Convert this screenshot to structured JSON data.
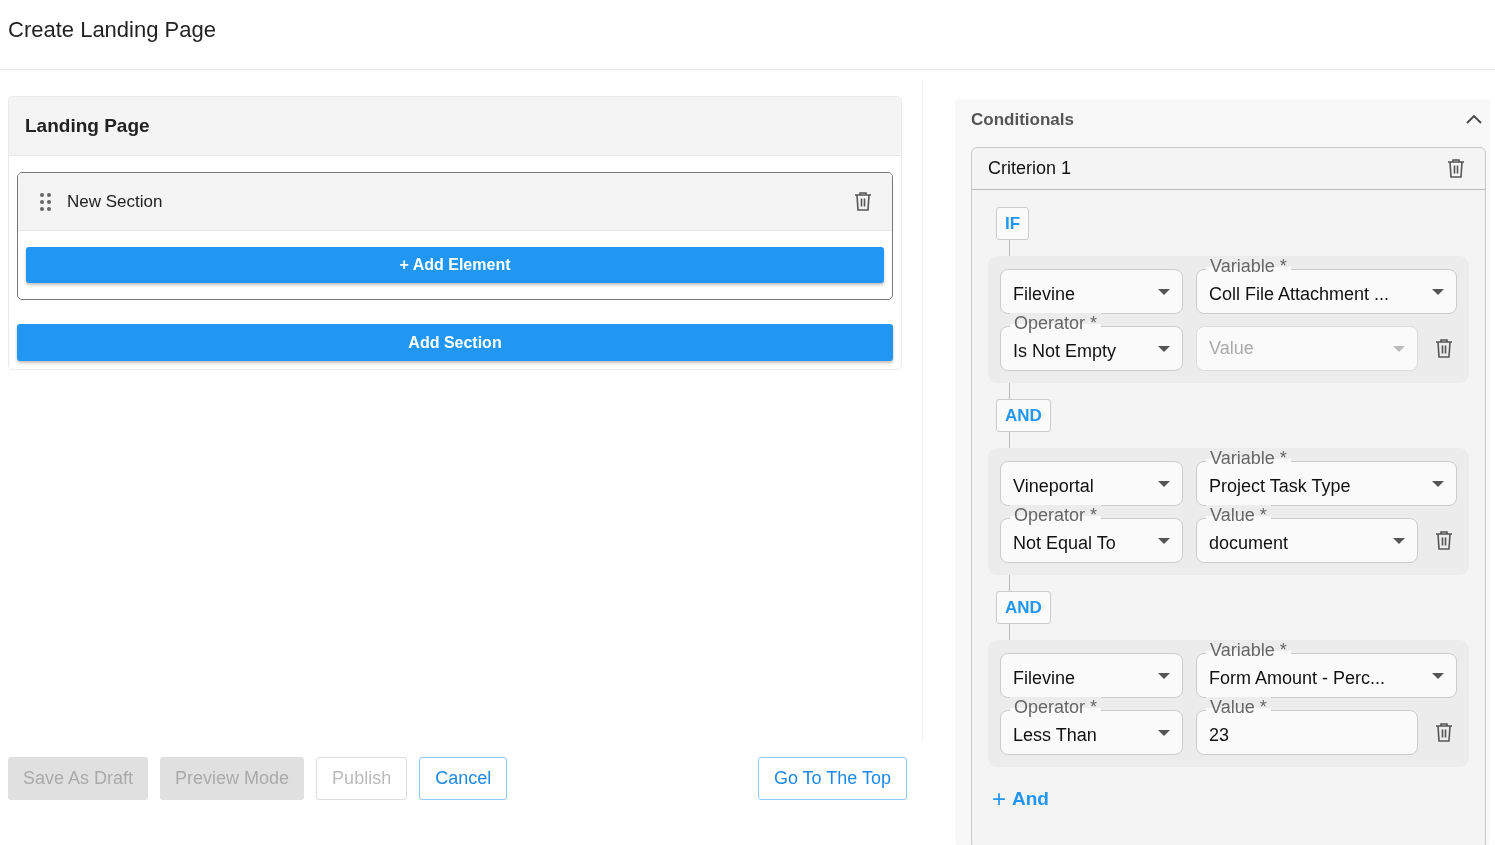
{
  "page_title": "Create Landing Page",
  "landing_page": {
    "title": "Landing Page",
    "sections": [
      {
        "title": "New Section",
        "add_element": "+ Add Element"
      }
    ],
    "add_section": "Add Section"
  },
  "footer_buttons": [
    {
      "label": "Save As Draft",
      "kind": "filled",
      "disabled": true
    },
    {
      "label": "Preview Mode",
      "kind": "filled",
      "disabled": true
    },
    {
      "label": "Publish",
      "kind": "outlined",
      "disabled": true
    },
    {
      "label": "Cancel",
      "kind": "outlined",
      "disabled": false
    }
  ],
  "go_top": {
    "label": "Go To The Top"
  },
  "conditionals": {
    "title": "Conditionals",
    "expanded": true,
    "criteria": [
      {
        "title": "Criterion 1",
        "conditions": [
          {
            "connector": "IF",
            "source": "Filevine",
            "variable": {
              "label": "Variable *",
              "value": "Coll File Attachment ..."
            },
            "operator": {
              "label": "Operator *",
              "value": "Is Not Empty"
            },
            "value": {
              "kind": "select",
              "placeholder": "Value",
              "disabled": true
            }
          },
          {
            "connector": "AND",
            "source": "Vineportal",
            "variable": {
              "label": "Variable *",
              "value": "Project Task Type"
            },
            "operator": {
              "label": "Operator *",
              "value": "Not Equal To"
            },
            "value": {
              "kind": "select",
              "label": "Value *",
              "value": "document",
              "disabled": false
            }
          },
          {
            "connector": "AND",
            "source": "Filevine",
            "variable": {
              "label": "Variable *",
              "value": "Form Amount - Perc..."
            },
            "operator": {
              "label": "Operator *",
              "value": "Less Than"
            },
            "value": {
              "kind": "text",
              "label": "Value *",
              "value": "23",
              "disabled": false
            }
          }
        ],
        "add_and": {
          "icon": "+",
          "label": "And"
        }
      }
    ]
  }
}
